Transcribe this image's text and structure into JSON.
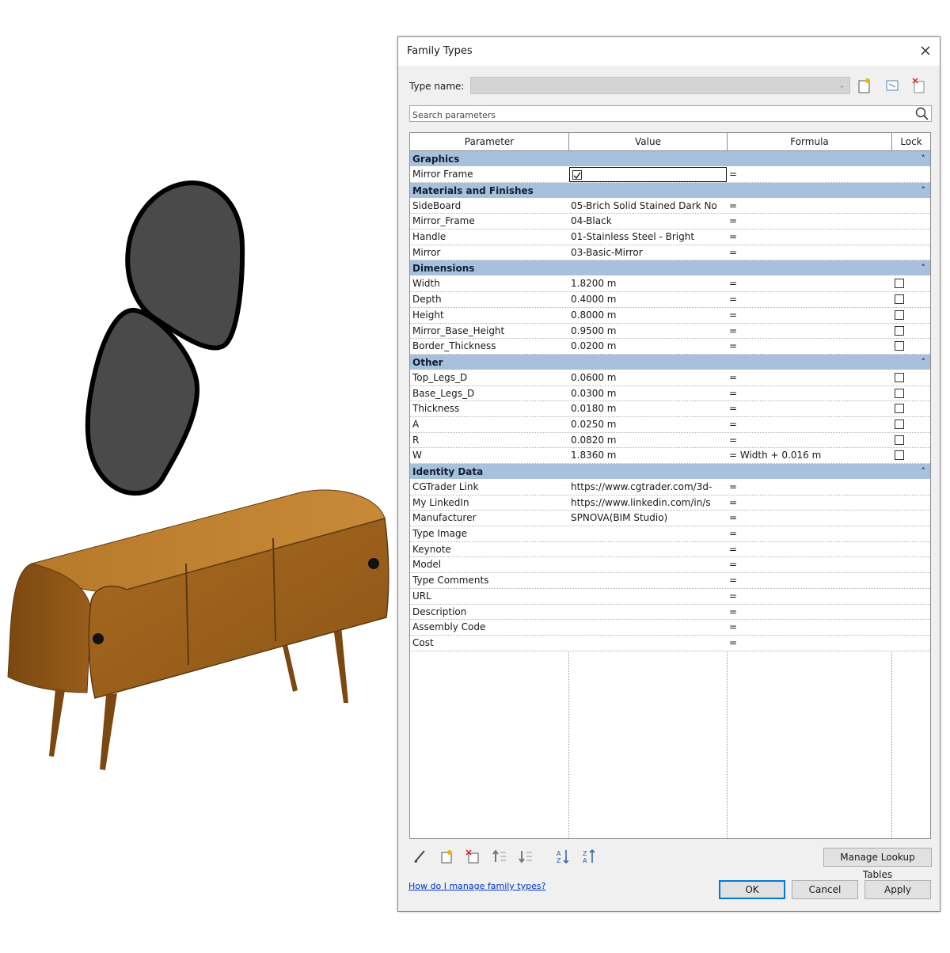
{
  "dialog": {
    "title": "Family Types",
    "type_name_label": "Type name:",
    "type_name_value": "",
    "search_placeholder": "Search parameters",
    "columns": [
      "Parameter",
      "Value",
      "Formula",
      "Lock"
    ],
    "groups": [
      {
        "name": "Graphics",
        "rows": [
          {
            "parameter": "Mirror Frame",
            "value": "",
            "formula": "=",
            "checkbox_value": true,
            "lock": null
          }
        ]
      },
      {
        "name": "Materials and Finishes",
        "rows": [
          {
            "parameter": "SideBoard",
            "value": "05-Brich Solid Stained Dark No",
            "formula": "=",
            "lock": null
          },
          {
            "parameter": "Mirror_Frame",
            "value": "04-Black",
            "formula": "=",
            "lock": null
          },
          {
            "parameter": "Handle",
            "value": "01-Stainless Steel - Bright",
            "formula": "=",
            "lock": null
          },
          {
            "parameter": "Mirror",
            "value": "03-Basic-Mirror",
            "formula": "=",
            "lock": null
          }
        ]
      },
      {
        "name": "Dimensions",
        "rows": [
          {
            "parameter": "Width",
            "value": "1.8200 m",
            "formula": "=",
            "lock": false
          },
          {
            "parameter": "Depth",
            "value": "0.4000 m",
            "formula": "=",
            "lock": false
          },
          {
            "parameter": "Height",
            "value": "0.8000 m",
            "formula": "=",
            "lock": false
          },
          {
            "parameter": "Mirror_Base_Height",
            "value": "0.9500 m",
            "formula": "=",
            "lock": false
          },
          {
            "parameter": "Border_Thickness",
            "value": "0.0200 m",
            "formula": "=",
            "lock": false
          }
        ]
      },
      {
        "name": "Other",
        "rows": [
          {
            "parameter": "Top_Legs_D",
            "value": "0.0600 m",
            "formula": "=",
            "lock": false
          },
          {
            "parameter": "Base_Legs_D",
            "value": "0.0300 m",
            "formula": "=",
            "lock": false
          },
          {
            "parameter": "Thickness",
            "value": "0.0180 m",
            "formula": "=",
            "lock": false
          },
          {
            "parameter": "A",
            "value": "0.0250 m",
            "formula": "=",
            "lock": false
          },
          {
            "parameter": "R",
            "value": "0.0820 m",
            "formula": "=",
            "lock": false
          },
          {
            "parameter": "W",
            "value": "1.8360 m",
            "formula": "= Width + 0.016 m",
            "lock": false
          }
        ]
      },
      {
        "name": "Identity Data",
        "rows": [
          {
            "parameter": "CGTrader Link",
            "value": "https://www.cgtrader.com/3d-",
            "formula": "=",
            "lock": null
          },
          {
            "parameter": "My LinkedIn",
            "value": "https://www.linkedin.com/in/s",
            "formula": "=",
            "lock": null
          },
          {
            "parameter": "Manufacturer",
            "value": "SPNOVA(BIM Studio)",
            "formula": "=",
            "lock": null
          },
          {
            "parameter": "Type Image",
            "value": "",
            "formula": "=",
            "lock": null
          },
          {
            "parameter": "Keynote",
            "value": "",
            "formula": "=",
            "lock": null
          },
          {
            "parameter": "Model",
            "value": "",
            "formula": "=",
            "lock": null
          },
          {
            "parameter": "Type Comments",
            "value": "",
            "formula": "=",
            "lock": null
          },
          {
            "parameter": "URL",
            "value": "",
            "formula": "=",
            "lock": null
          },
          {
            "parameter": "Description",
            "value": "",
            "formula": "=",
            "lock": null
          },
          {
            "parameter": "Assembly Code",
            "value": "",
            "formula": "=",
            "lock": null
          },
          {
            "parameter": "Cost",
            "value": "",
            "formula": "=",
            "lock": null
          }
        ]
      }
    ],
    "buttons": {
      "manage_lookup": "Manage Lookup Tables",
      "ok": "OK",
      "cancel": "Cancel",
      "apply": "Apply"
    },
    "help_link": "How do I manage family types?",
    "colors": {
      "group_header": "#a7c0db",
      "accent": "#0078d7",
      "link": "#0033cc"
    }
  },
  "scene": {
    "mirror_color": "#4a4a4a",
    "wood_color": "#a86e24"
  }
}
